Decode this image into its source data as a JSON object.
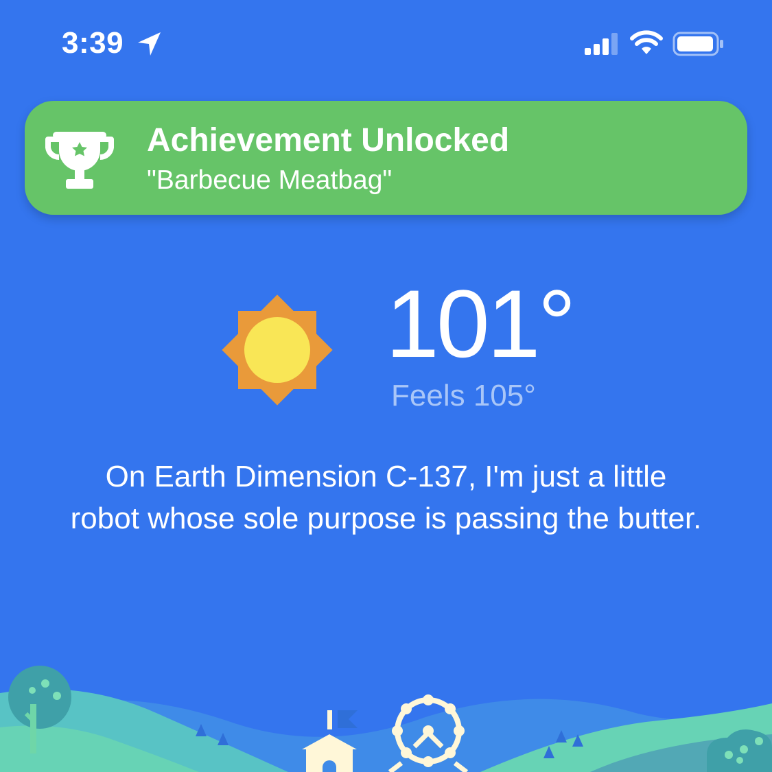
{
  "status_bar": {
    "time": "3:39",
    "icons": [
      "location-arrow-icon",
      "cellular-signal-icon",
      "wifi-icon",
      "battery-icon"
    ]
  },
  "achievement": {
    "title": "Achievement Unlocked",
    "subtitle": "\"Barbecue Meatbag\"",
    "icon": "trophy-icon",
    "color": "#66c468"
  },
  "weather": {
    "temperature": "101°",
    "feels_like": "Feels 105°",
    "condition_icon": "sun-icon",
    "message": "On Earth Dimension C-137, I'm just a little robot whose sole purpose is passing the butter."
  },
  "colors": {
    "background": "#3475ee",
    "sun_outer": "#e99a3a",
    "sun_inner": "#f9e656",
    "hills": "#67d3b5"
  }
}
